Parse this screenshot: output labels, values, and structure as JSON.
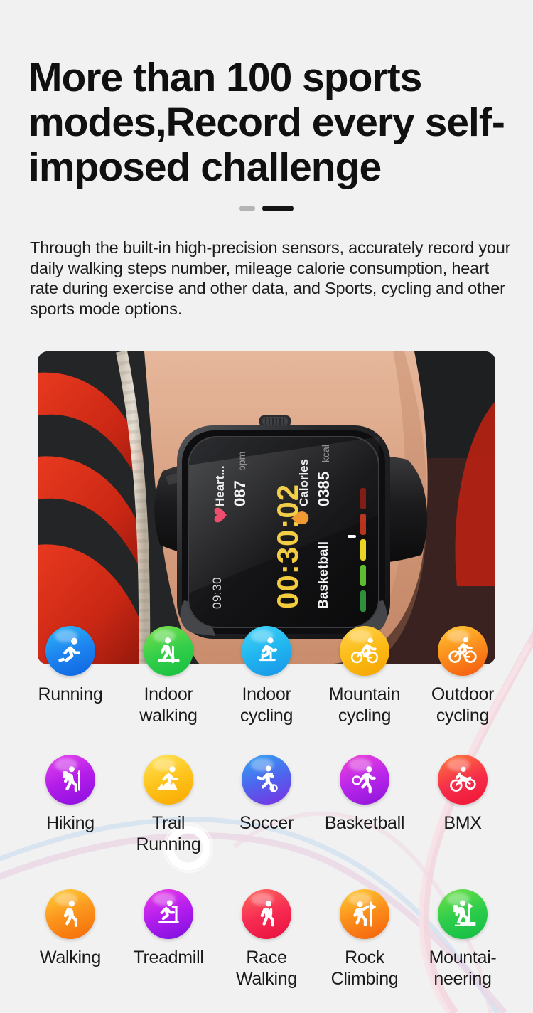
{
  "headline": "More than 100 sports modes,Record every self-imposed challenge",
  "pager": {
    "dots": [
      {
        "name": "page-indicator-1",
        "state": "inactive"
      },
      {
        "name": "page-indicator-2",
        "state": "active"
      }
    ]
  },
  "lede": "Through the built-in high-precision sensors, accurately record your daily walking steps number, mileage calorie consumption, heart rate during exercise and other data, and Sports, cycling and other sports mode options.",
  "photo": {
    "alt": "Wrist wearing a black square smartwatch in front of red gym equipment",
    "watch_screen": {
      "time": "09:30",
      "sport": "Basketball",
      "timer": "00:30:02",
      "heart_label": "Heart...",
      "heart_value": "087",
      "heart_unit": "bpm",
      "calories_label": "Calories",
      "calories_value": "0385",
      "calories_unit": "kcal"
    }
  },
  "modes": {
    "rows": [
      [
        {
          "label": "Running",
          "icon": "running-icon",
          "color": "#1e86f0",
          "style": "g-running"
        },
        {
          "label": "Indoor walking",
          "icon": "indoor-walking-icon",
          "color": "#35cf4a",
          "style": "g-indoorwalking"
        },
        {
          "label": "Indoor cycling",
          "icon": "indoor-cycling-icon",
          "color": "#22b6f0",
          "style": "g-indoorcycling"
        },
        {
          "label": "Mountain cycling",
          "icon": "mountain-cycling-icon",
          "color": "#fcbb16",
          "style": "g-mountaincyc"
        },
        {
          "label": "Outdoor cycling",
          "icon": "outdoor-cycling-icon",
          "color": "#fb8d1d",
          "style": "g-outdoorcyc"
        }
      ],
      [
        {
          "label": "Hiking",
          "icon": "hiking-icon",
          "color": "#b41de8",
          "style": "g-hiking"
        },
        {
          "label": "Trail Running",
          "icon": "trail-running-icon",
          "color": "#fec41c",
          "style": "g-trailrunning"
        },
        {
          "label": "Soccer",
          "icon": "soccer-icon",
          "color": "#4f63ed",
          "style": "g-soccer"
        },
        {
          "label": "Basketball",
          "icon": "basketball-icon",
          "color": "#ba27ea",
          "style": "g-basketball"
        },
        {
          "label": "BMX",
          "icon": "bmx-icon",
          "color": "#f62f49",
          "style": "g-bmx"
        }
      ],
      [
        {
          "label": "Walking",
          "icon": "walking-icon",
          "color": "#fb941c",
          "style": "g-walking"
        },
        {
          "label": "Treadmill",
          "icon": "treadmill-icon",
          "color": "#b31ded",
          "style": "g-treadmill"
        },
        {
          "label": "Race Walking",
          "icon": "race-walking-icon",
          "color": "#f62b52",
          "style": "g-racewalking"
        },
        {
          "label": "Rock Climbing",
          "icon": "rock-climbing-icon",
          "color": "#fb8e1b",
          "style": "g-rockclimbing"
        },
        {
          "label": "Mountai-neering",
          "icon": "mountaineering-icon",
          "color": "#2ecd4b",
          "style": "g-mountaineer"
        }
      ]
    ]
  },
  "theme": {
    "background": "#f1f1f1",
    "text": "#1a1a1a",
    "accent_dark": "#141414",
    "pill_inactive": "#b4b4b4"
  }
}
